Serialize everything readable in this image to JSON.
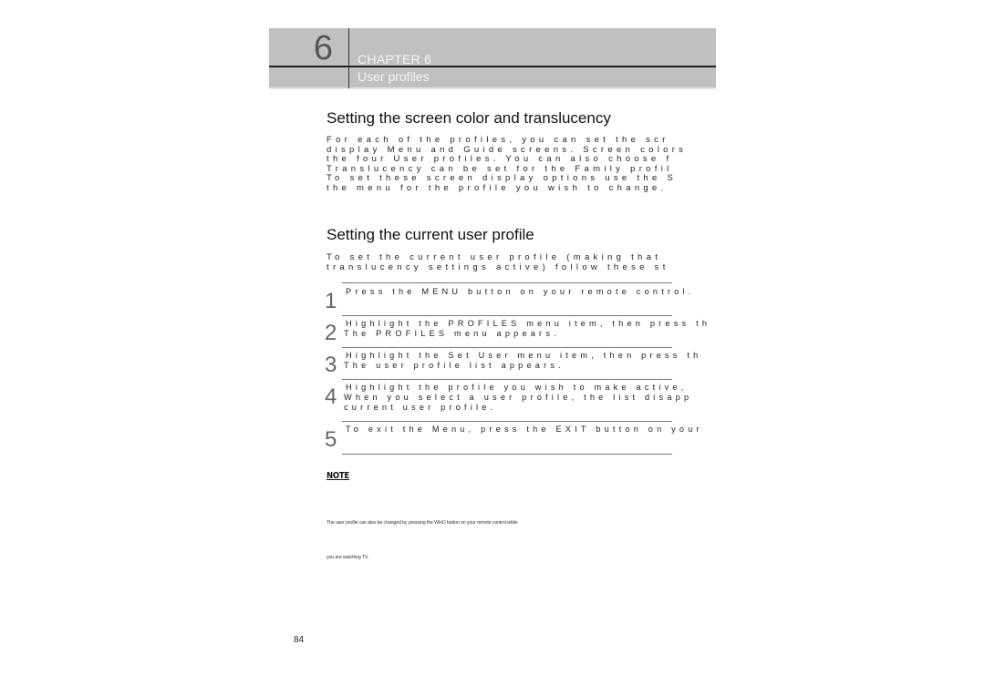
{
  "header": {
    "chapter_number": "6",
    "chapter_label": "CHAPTER 6",
    "chapter_title": "User profiles"
  },
  "sections": [
    {
      "title": "Setting the screen color and translucency",
      "lines": [
        "For each of the profiles, you can set the scr",
        "display Menu and Guide screens. Screen colors",
        "the four User profiles. You can also choose f",
        "Translucency can be set for the Family profil",
        "To set these screen display options use the S",
        "the menu for the profile you wish to change."
      ]
    },
    {
      "title": "Setting the current user profile",
      "lines": [
        "To set the current user profile (making that",
        "translucency settings active) follow these st"
      ]
    }
  ],
  "steps": [
    {
      "number": "1",
      "lines": [
        "Press the MENU button on your remote control."
      ]
    },
    {
      "number": "2",
      "lines": [
        "Highlight the PROFILES menu item, then press th",
        "The PROFILES menu appears."
      ]
    },
    {
      "number": "3",
      "lines": [
        "Highlight the Set User menu item, then press th",
        "The user profile list appears."
      ]
    },
    {
      "number": "4",
      "lines": [
        "Highlight the profile you wish to make active,",
        "When you select a user profile, the list disapp",
        "current user profile."
      ]
    },
    {
      "number": "5",
      "lines": [
        "To exit the Menu, press the EXIT button on your"
      ]
    }
  ],
  "note": {
    "heading": "NOTE",
    "lines": [
      "The user profile can also be changed by pressing the WHO button on your remote control while",
      "you are watching TV."
    ]
  },
  "page_number": "84"
}
